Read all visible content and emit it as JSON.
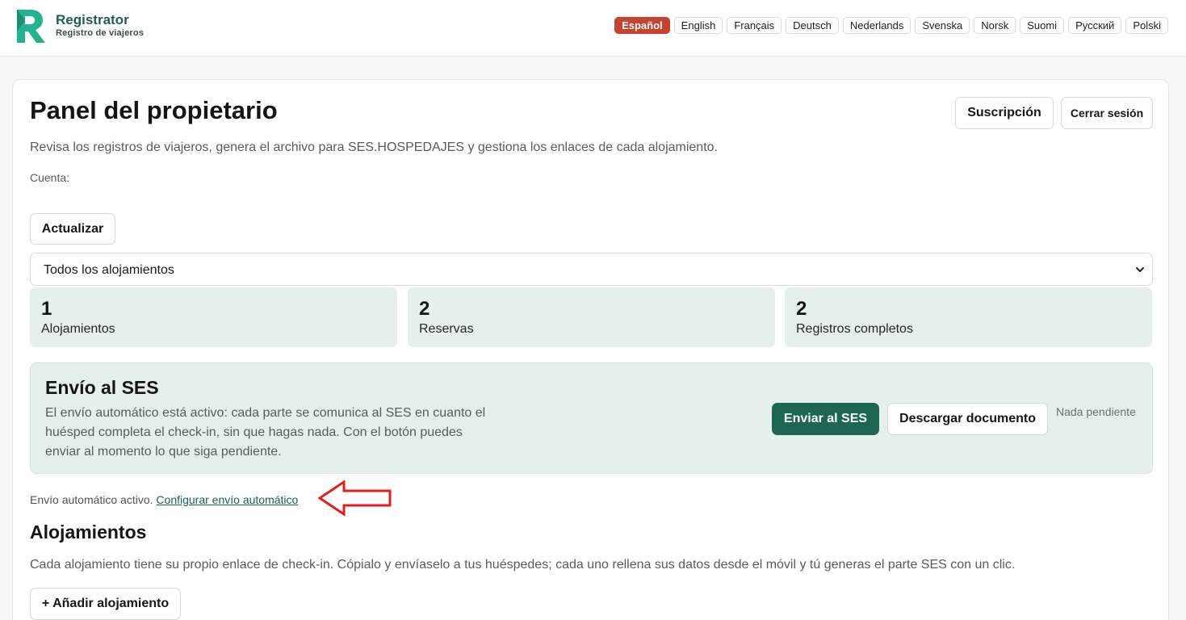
{
  "brand": {
    "name": "Registrator",
    "subtitle": "Registro de viajeros",
    "accent": "#1d6654"
  },
  "languages": [
    {
      "label": "Español",
      "active": true
    },
    {
      "label": "English",
      "active": false
    },
    {
      "label": "Français",
      "active": false
    },
    {
      "label": "Deutsch",
      "active": false
    },
    {
      "label": "Nederlands",
      "active": false
    },
    {
      "label": "Svenska",
      "active": false
    },
    {
      "label": "Norsk",
      "active": false
    },
    {
      "label": "Suomi",
      "active": false
    },
    {
      "label": "Русский",
      "active": false
    },
    {
      "label": "Polski",
      "active": false
    }
  ],
  "header": {
    "title": "Panel del propietario",
    "subscription_label": "Suscripción",
    "logout_label": "Cerrar sesión",
    "description": "Revisa los registros de viajeros, genera el archivo para SES.HOSPEDAJES y gestiona los enlaces de cada alojamiento.",
    "account_label": "Cuenta:"
  },
  "toolbar": {
    "refresh_label": "Actualizar",
    "filter_selected": "Todos los alojamientos"
  },
  "stats": [
    {
      "value": "1",
      "label": "Alojamientos"
    },
    {
      "value": "2",
      "label": "Reservas"
    },
    {
      "value": "2",
      "label": "Registros completos"
    }
  ],
  "ses": {
    "title": "Envío al SES",
    "text": "El envío automático está activo: cada parte se comunica al SES en cuanto el huésped completa el check-in, sin que hagas nada. Con el botón puedes enviar al momento lo que siga pendiente.",
    "send_label": "Enviar al SES",
    "download_label": "Descargar documento",
    "status": "Nada pendiente"
  },
  "auto_send": {
    "status_text": "Envío automático activo.",
    "link_label": "Configurar envío automático"
  },
  "lodgings": {
    "title": "Alojamientos",
    "description": "Cada alojamiento tiene su propio enlace de check-in. Cópialo y envíaselo a tus huéspedes; cada uno rellena sus datos desde el móvil y tú generas el parte SES con un clic.",
    "add_label": "+ Añadir alojamiento"
  }
}
